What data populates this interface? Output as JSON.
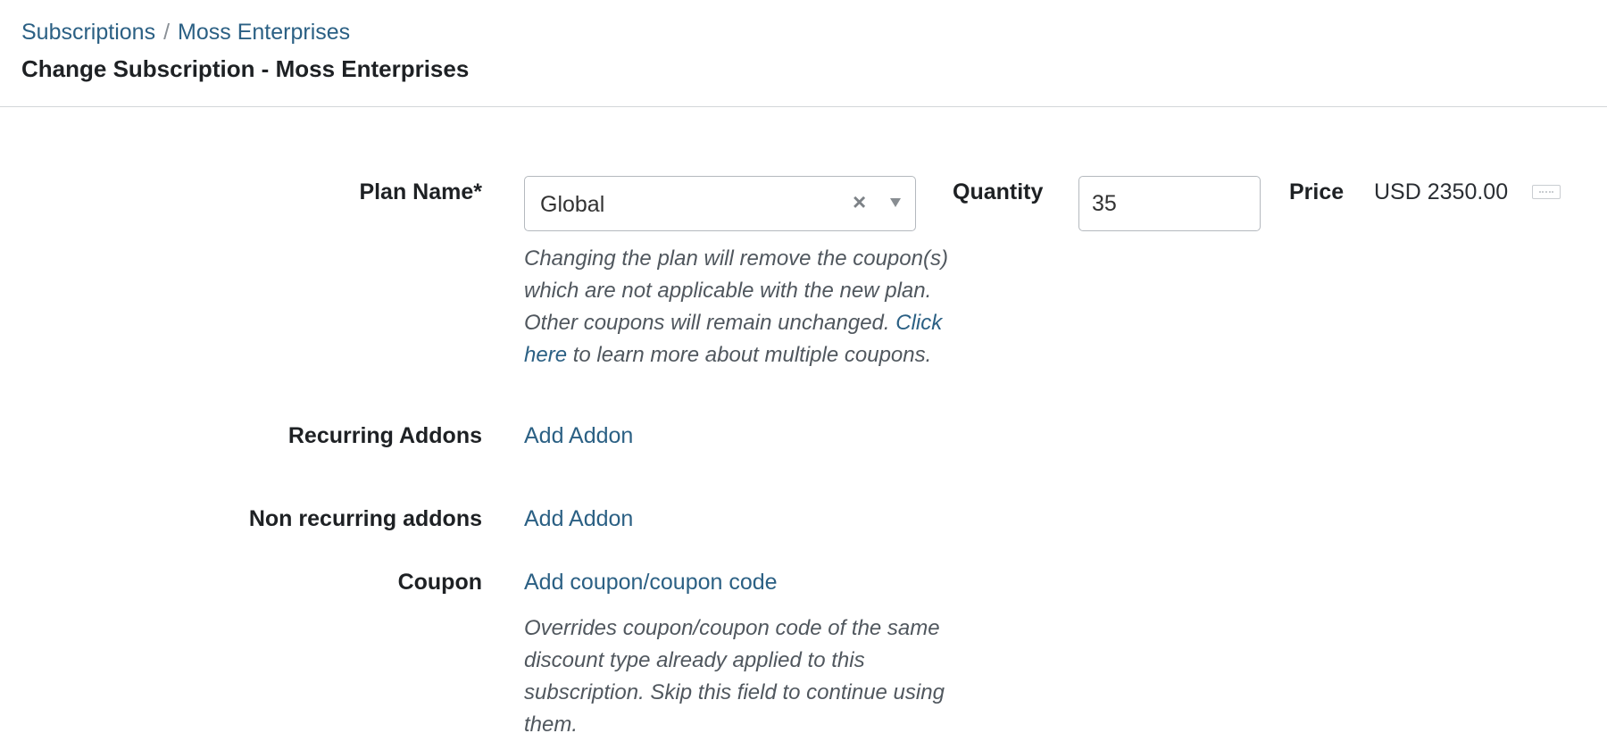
{
  "breadcrumb": {
    "root": "Subscriptions",
    "separator": "/",
    "current": "Moss Enterprises"
  },
  "page_title": "Change Subscription - Moss Enterprises",
  "form": {
    "plan": {
      "label": "Plan Name*",
      "value": "Global",
      "clear_icon": "×"
    },
    "quantity": {
      "label": "Quantity",
      "value": "35"
    },
    "price": {
      "label": "Price",
      "value": "USD 2350.00"
    },
    "plan_help": {
      "text_before": "Changing the plan will remove the coupon(s) which are not applicable with the new plan. Other coupons will remain unchanged. ",
      "link": "Click here",
      "text_after": " to learn more about multiple coupons."
    },
    "recurring_addons": {
      "label": "Recurring Addons",
      "link": "Add Addon"
    },
    "non_recurring_addons": {
      "label": "Non recurring addons",
      "link": "Add Addon"
    },
    "coupon": {
      "label": "Coupon",
      "link": "Add coupon/coupon code",
      "help": "Overrides coupon/coupon code of the same discount type already applied to this subscription. Skip this field to continue using them."
    }
  },
  "colors": {
    "link": "#2b6084",
    "label": "#1e2124",
    "help": "#50575e",
    "divider": "#d3d6d9"
  },
  "icons": {
    "select_clear": "close-icon",
    "select_arrow": "chevron-down-icon",
    "price_more": "ellipsis-icon"
  }
}
